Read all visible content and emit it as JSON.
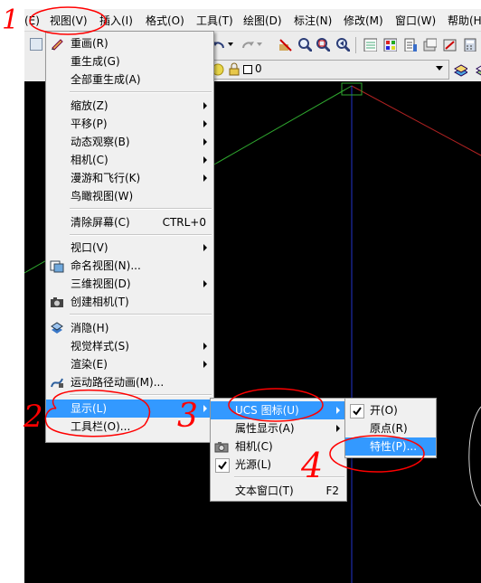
{
  "menubar": {
    "items": [
      {
        "label": "(E)"
      },
      {
        "label": "视图(V)"
      },
      {
        "label": "插入(I)"
      },
      {
        "label": "格式(O)"
      },
      {
        "label": "工具(T)"
      },
      {
        "label": "绘图(D)"
      },
      {
        "label": "标注(N)"
      },
      {
        "label": "修改(M)"
      },
      {
        "label": "窗口(W)"
      },
      {
        "label": "帮助(H"
      }
    ]
  },
  "toolbar": {
    "layer_value": "0"
  },
  "view_menu": {
    "items": [
      {
        "label": "重画(R)"
      },
      {
        "label": "重生成(G)"
      },
      {
        "label": "全部重生成(A)"
      },
      {
        "label": "缩放(Z)"
      },
      {
        "label": "平移(P)"
      },
      {
        "label": "动态观察(B)"
      },
      {
        "label": "相机(C)"
      },
      {
        "label": "漫游和飞行(K)"
      },
      {
        "label": "鸟瞰视图(W)"
      },
      {
        "label": "清除屏幕(C)",
        "accel": "CTRL+0"
      },
      {
        "label": "视口(V)"
      },
      {
        "label": "命名视图(N)..."
      },
      {
        "label": "三维视图(D)"
      },
      {
        "label": "创建相机(T)"
      },
      {
        "label": "消隐(H)"
      },
      {
        "label": "视觉样式(S)"
      },
      {
        "label": "渲染(E)"
      },
      {
        "label": "运动路径动画(M)..."
      },
      {
        "label": "显示(L)"
      },
      {
        "label": "工具栏(O)..."
      }
    ]
  },
  "display_menu": {
    "items": [
      {
        "label": "UCS 图标(U)"
      },
      {
        "label": "属性显示(A)"
      },
      {
        "label": "相机(C)"
      },
      {
        "label": "光源(L)"
      },
      {
        "label": "文本窗口(T)",
        "accel": "F2"
      }
    ]
  },
  "ucs_menu": {
    "items": [
      {
        "label": "开(O)"
      },
      {
        "label": "原点(R)"
      },
      {
        "label": "特性(P)..."
      }
    ]
  },
  "annotations": {
    "one": "1",
    "two": "2",
    "three": "3",
    "four": "4"
  },
  "colors": {
    "highlight": "#3399ff",
    "annotation": "#ff0000",
    "canvas": "#000000"
  }
}
